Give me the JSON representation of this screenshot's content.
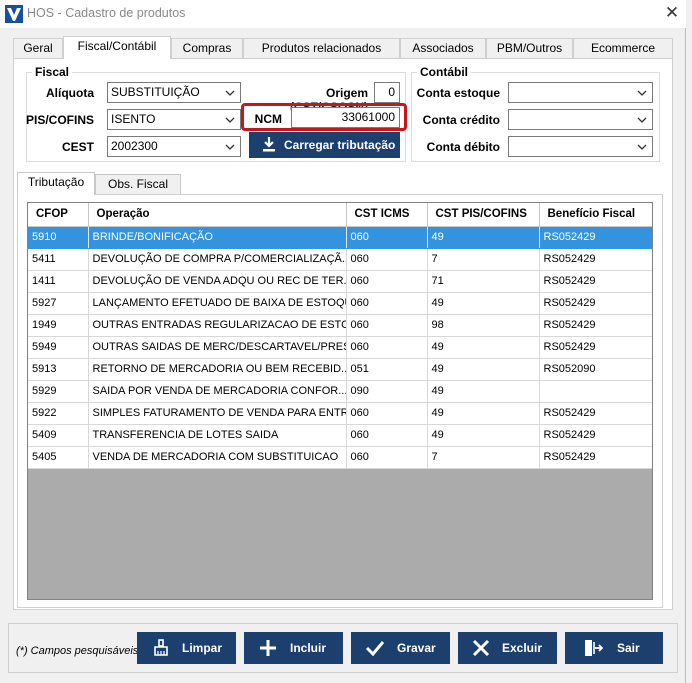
{
  "window": {
    "title": "HOS - Cadastro de produtos"
  },
  "tabs": [
    {
      "label": "Geral"
    },
    {
      "label": "Fiscal/Contábil"
    },
    {
      "label": "Compras"
    },
    {
      "label": "Produtos relacionados"
    },
    {
      "label": "Associados"
    },
    {
      "label": "PBM/Outros"
    },
    {
      "label": "Ecommerce"
    }
  ],
  "fiscal": {
    "title": "Fiscal",
    "aliquota_label": "Alíquota",
    "aliquota_value": "SUBSTITUIÇÃO",
    "piscofins_label": "PIS/COFINS",
    "piscofins_value": "ISENTO",
    "cest_label": "CEST",
    "cest_value": "2002300",
    "origem_label": "Origem (CST/CSOSN)",
    "origem_value": "0",
    "ncm_label": "NCM",
    "ncm_value": "33061000",
    "carregar_button": "Carregar tributação"
  },
  "contabil": {
    "title": "Contábil",
    "estoque_label": "Conta estoque",
    "estoque_value": "",
    "credito_label": "Conta crédito",
    "credito_value": "",
    "debito_label": "Conta débito",
    "debito_value": ""
  },
  "subtabs": [
    {
      "label": "Tributação"
    },
    {
      "label": "Obs. Fiscal"
    }
  ],
  "table": {
    "columns": [
      "CFOP",
      "Operação",
      "CST ICMS",
      "CST PIS/COFINS",
      "Benefício Fiscal"
    ],
    "rows": [
      {
        "cfop": "5910",
        "operacao": "BRINDE/BONIFICAÇÃO",
        "cst_icms": "060",
        "cst_pis": "49",
        "beneficio": "RS052429"
      },
      {
        "cfop": "5411",
        "operacao": "DEVOLUÇÃO DE COMPRA P/COMERCIALIZAÇÃ...",
        "cst_icms": "060",
        "cst_pis": "7",
        "beneficio": "RS052429"
      },
      {
        "cfop": "1411",
        "operacao": "DEVOLUÇÃO DE VENDA ADQU OU REC DE TER...",
        "cst_icms": "060",
        "cst_pis": "71",
        "beneficio": "RS052429"
      },
      {
        "cfop": "5927",
        "operacao": "LANÇAMENTO EFETUADO DE BAIXA DE ESTOQU...",
        "cst_icms": "060",
        "cst_pis": "49",
        "beneficio": "RS052429"
      },
      {
        "cfop": "1949",
        "operacao": "OUTRAS ENTRADAS REGULARIZACAO DE ESTO...",
        "cst_icms": "060",
        "cst_pis": "98",
        "beneficio": "RS052429"
      },
      {
        "cfop": "5949",
        "operacao": "OUTRAS SAIDAS DE MERC/DESCARTAVEL/PREST...",
        "cst_icms": "060",
        "cst_pis": "49",
        "beneficio": "RS052429"
      },
      {
        "cfop": "5913",
        "operacao": "RETORNO DE MERCADORIA OU BEM RECEBID...",
        "cst_icms": "051",
        "cst_pis": "49",
        "beneficio": "RS052090"
      },
      {
        "cfop": "5929",
        "operacao": "SAIDA POR VENDA DE MERCADORIA CONFOR...",
        "cst_icms": "090",
        "cst_pis": "49",
        "beneficio": ""
      },
      {
        "cfop": "5922",
        "operacao": "SIMPLES FATURAMENTO DE VENDA PARA ENTRE...",
        "cst_icms": "060",
        "cst_pis": "49",
        "beneficio": "RS052429"
      },
      {
        "cfop": "5409",
        "operacao": "TRANSFERENCIA DE LOTES SAIDA",
        "cst_icms": "060",
        "cst_pis": "49",
        "beneficio": "RS052429"
      },
      {
        "cfop": "5405",
        "operacao": "VENDA DE MERCADORIA COM SUBSTITUICAO",
        "cst_icms": "060",
        "cst_pis": "7",
        "beneficio": "RS052429"
      }
    ]
  },
  "footer": {
    "hint": "(*) Campos pesquisáveis",
    "limpar": "Limpar",
    "incluir": "Incluir",
    "gravar": "Gravar",
    "excluir": "Excluir",
    "sair": "Sair"
  },
  "colors": {
    "button_bg": "#1c3f6e",
    "selection": "#3393df",
    "highlight_border": "#c8171c"
  }
}
